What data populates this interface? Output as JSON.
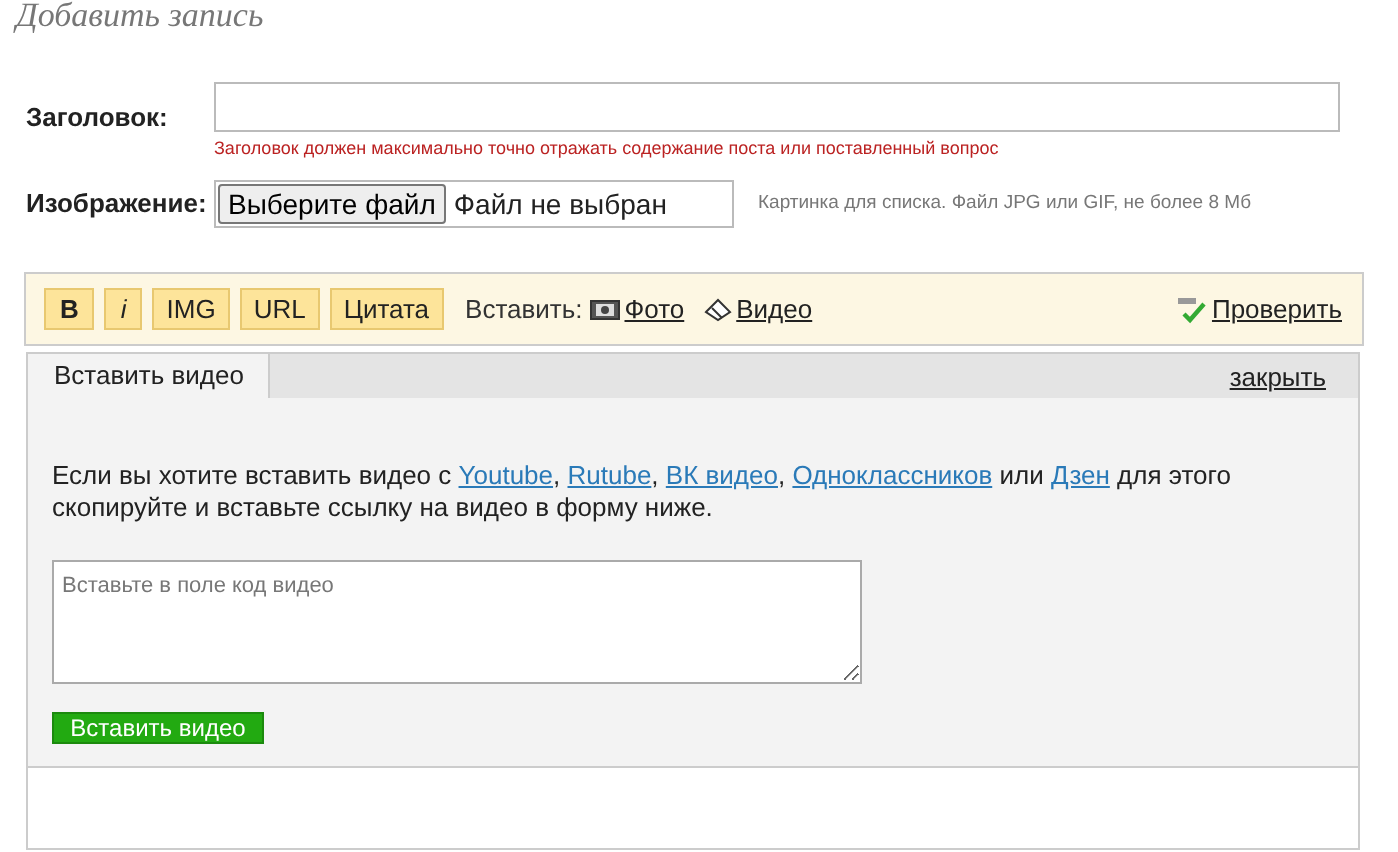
{
  "page_title": "Добавить запись",
  "title_field": {
    "label": "Заголовок:",
    "hint": "Заголовок должен максимально точно отражать содержание поста или поставленный вопрос"
  },
  "image_field": {
    "label": "Изображение:",
    "button": "Выберите файл",
    "status": "Файл не выбран",
    "hint": "Картинка для списка. Файл JPG или GIF, не более 8 Мб"
  },
  "toolbar": {
    "format_buttons": [
      "B",
      "i",
      "IMG",
      "URL",
      "Цитата"
    ],
    "insert_label": "Вставить:",
    "insert_links": [
      {
        "kind": "photo",
        "label": "Фото"
      },
      {
        "kind": "video",
        "label": "Видео"
      }
    ],
    "check": "Проверить"
  },
  "panel": {
    "tabs": [
      {
        "label": "Вставить видео",
        "selected": true
      }
    ],
    "close": "закрыть",
    "intro": [
      {
        "kind": "text",
        "text": "Если вы хотите вставить видео с "
      },
      {
        "kind": "link",
        "text": "Youtube"
      },
      {
        "kind": "text",
        "text": ", "
      },
      {
        "kind": "link",
        "text": "Rutube"
      },
      {
        "kind": "text",
        "text": ", "
      },
      {
        "kind": "link",
        "text": "ВК видео"
      },
      {
        "kind": "text",
        "text": ", "
      },
      {
        "kind": "link",
        "text": "Одноклассников"
      },
      {
        "kind": "text",
        "text": " или "
      },
      {
        "kind": "link",
        "text": "Дзен"
      },
      {
        "kind": "text",
        "text": " для этого скопируйте и вставьте ссылку на видео в форму ниже."
      }
    ],
    "code_placeholder": "Вставьте в поле код видео",
    "submit": "Вставить видео"
  }
}
